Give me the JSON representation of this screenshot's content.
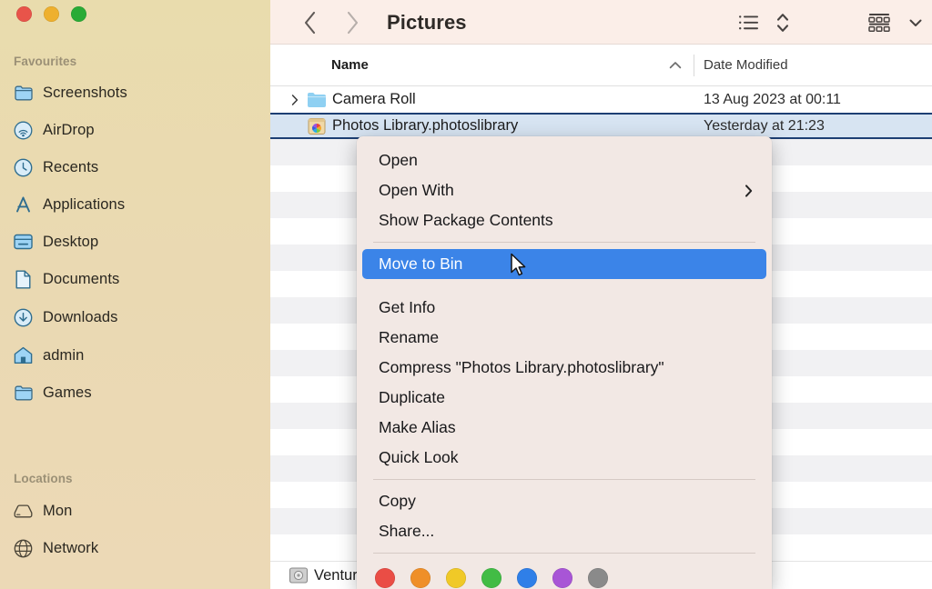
{
  "window": {
    "traffic_lights": [
      {
        "name": "close",
        "color": "#e8544a"
      },
      {
        "name": "minimize",
        "color": "#eeb02e"
      },
      {
        "name": "zoom",
        "color": "#2aab36"
      }
    ]
  },
  "sidebar": {
    "sections": [
      {
        "title": "Favourites",
        "items": [
          {
            "label": "Screenshots",
            "icon": "folder-icon"
          },
          {
            "label": "AirDrop",
            "icon": "airdrop-icon"
          },
          {
            "label": "Recents",
            "icon": "clock-icon"
          },
          {
            "label": "Applications",
            "icon": "applications-icon"
          },
          {
            "label": "Desktop",
            "icon": "desktop-icon"
          },
          {
            "label": "Documents",
            "icon": "document-icon"
          },
          {
            "label": "Downloads",
            "icon": "download-icon"
          },
          {
            "label": "admin",
            "icon": "home-icon"
          },
          {
            "label": "Games",
            "icon": "folder-icon"
          }
        ]
      },
      {
        "title": "Locations",
        "items": [
          {
            "label": "Mon",
            "icon": "harddisk-icon"
          },
          {
            "label": "Network",
            "icon": "globe-icon"
          }
        ]
      }
    ]
  },
  "toolbar": {
    "back_icon": "chevron-left-icon",
    "forward_icon": "chevron-right-icon",
    "title": "Pictures",
    "view_list_icon": "list-view-icon",
    "group_sort_icon": "sort-updown-icon",
    "group_by_icon": "group-grid-icon",
    "group_by_chevron_icon": "chevron-down-icon"
  },
  "columns": {
    "name": "Name",
    "sort_indicator_icon": "chevron-up-icon",
    "date_modified": "Date Modified"
  },
  "files": [
    {
      "name": "Camera Roll",
      "date": "13 Aug 2023 at 00:11",
      "icon": "folder-icon",
      "has_disclosure": true,
      "selected": false
    },
    {
      "name": "Photos Library.photoslibrary",
      "date": "Yesterday at 21:23",
      "icon": "photos-library-icon",
      "has_disclosure": false,
      "selected": true
    }
  ],
  "bottom_row": {
    "name": "Ventur",
    "icon": "disk-image-icon"
  },
  "context_menu": {
    "groups": [
      {
        "items": [
          {
            "label": "Open",
            "submenu": false,
            "highlight": false
          },
          {
            "label": "Open With",
            "submenu": true,
            "highlight": false
          },
          {
            "label": "Show Package Contents",
            "submenu": false,
            "highlight": false
          }
        ]
      },
      {
        "items": [
          {
            "label": "Move to Bin",
            "submenu": false,
            "highlight": true
          }
        ]
      },
      {
        "items": [
          {
            "label": "Get Info",
            "submenu": false,
            "highlight": false
          },
          {
            "label": "Rename",
            "submenu": false,
            "highlight": false
          },
          {
            "label": "Compress \"Photos Library.photoslibrary\"",
            "submenu": false,
            "highlight": false
          },
          {
            "label": "Duplicate",
            "submenu": false,
            "highlight": false
          },
          {
            "label": "Make Alias",
            "submenu": false,
            "highlight": false
          },
          {
            "label": "Quick Look",
            "submenu": false,
            "highlight": false
          }
        ]
      },
      {
        "items": [
          {
            "label": "Copy",
            "submenu": false,
            "highlight": false
          },
          {
            "label": "Share...",
            "submenu": false,
            "highlight": false
          }
        ]
      }
    ],
    "tags": [
      {
        "name": "red",
        "color": "#ea4d45"
      },
      {
        "name": "orange",
        "color": "#ef8f28"
      },
      {
        "name": "yellow",
        "color": "#f0c927"
      },
      {
        "name": "green",
        "color": "#42bc45"
      },
      {
        "name": "blue",
        "color": "#2f7fe8"
      },
      {
        "name": "purple",
        "color": "#a martian"
      },
      {
        "name": "gray",
        "color": "#8a8a8a"
      }
    ],
    "highlight_color": "#3b84e8"
  },
  "cursor": {
    "icon": "mouse-pointer-icon"
  }
}
